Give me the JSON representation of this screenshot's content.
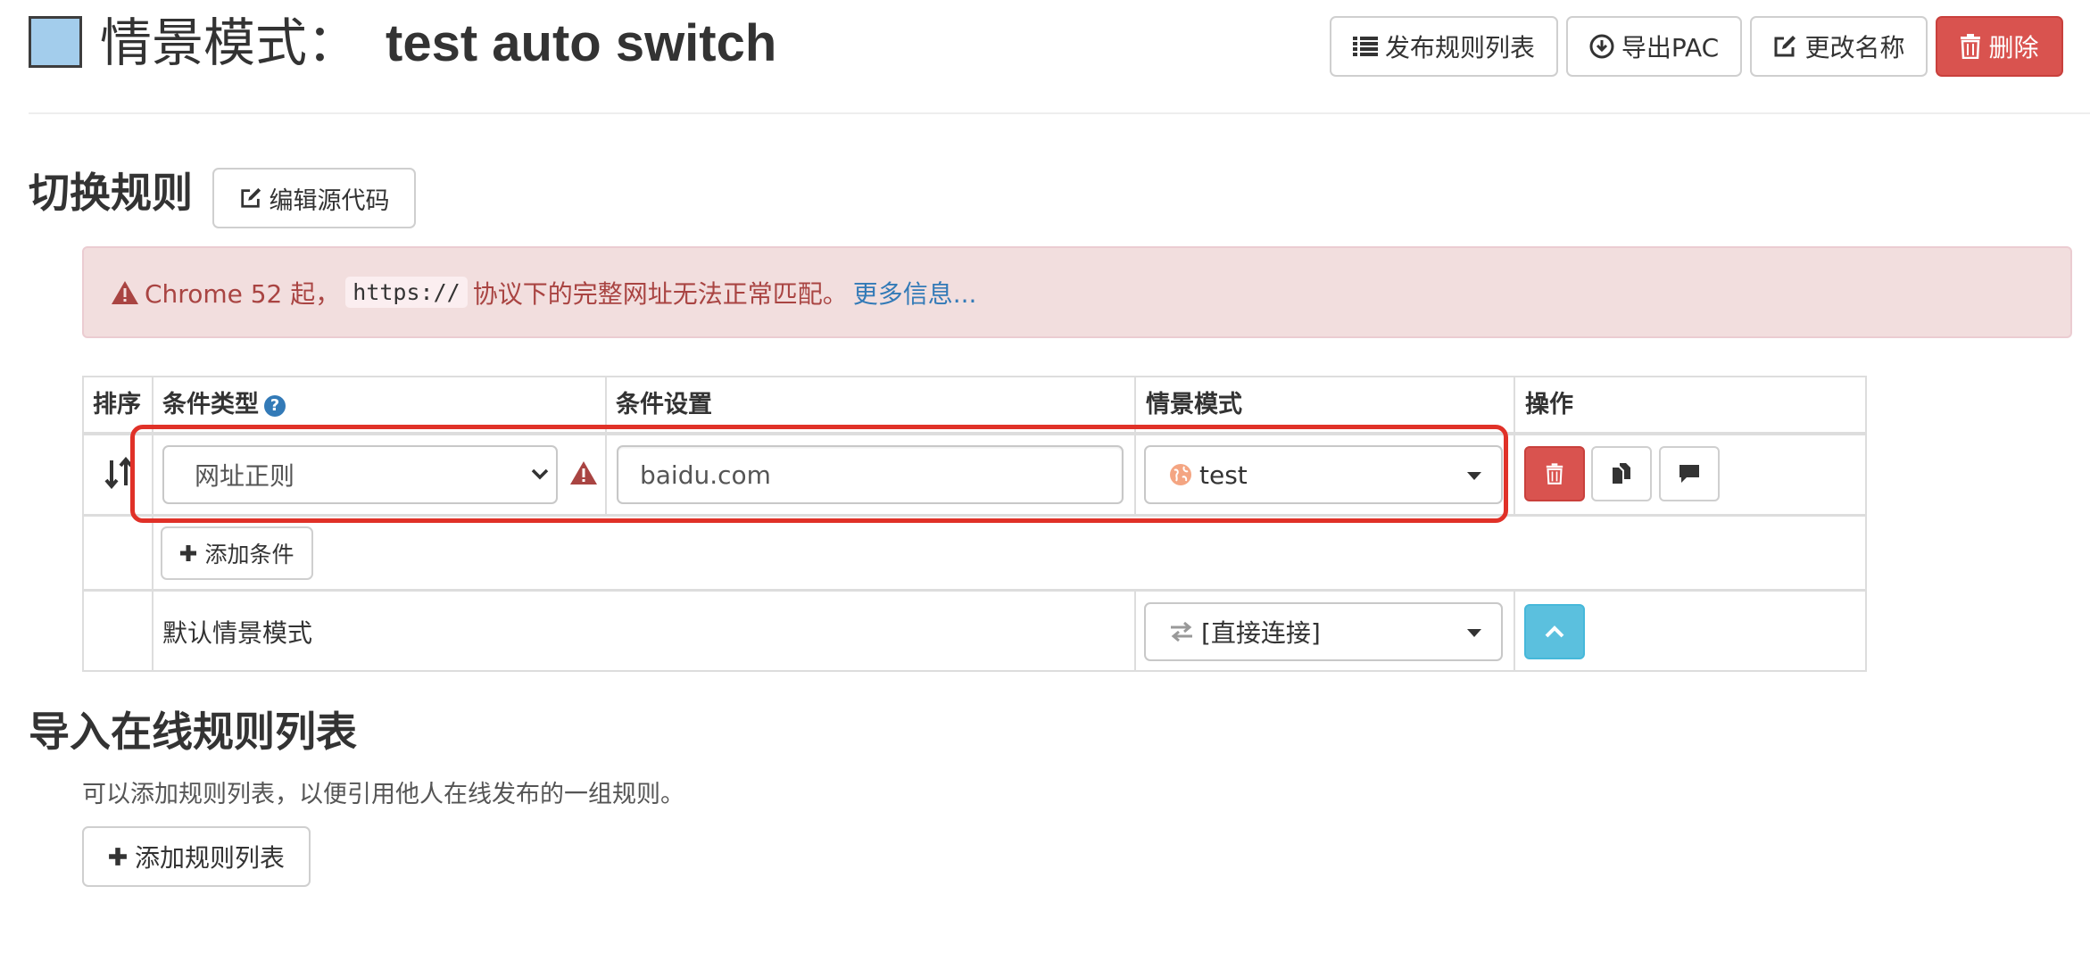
{
  "header": {
    "title_prefix": "情景模式：",
    "profile_name": "test auto switch",
    "swatch_color": "#a3cdec",
    "buttons": {
      "publish": "发布规则列表",
      "export_pac": "导出PAC",
      "rename": "更改名称",
      "delete": "删除"
    }
  },
  "switch_rules": {
    "heading": "切换规则",
    "edit_source_button": "编辑源代码",
    "alert": {
      "prefix": "Chrome 52 起，",
      "code": "https://",
      "suffix": "协议下的完整网址无法正常匹配。",
      "link": "更多信息..."
    },
    "table": {
      "headers": {
        "sort": "排序",
        "condition_type": "条件类型",
        "condition_setting": "条件设置",
        "profile": "情景模式",
        "actions": "操作"
      },
      "rows": [
        {
          "condition_type": "网址正则",
          "condition_value": "baidu.com",
          "profile": "test"
        }
      ],
      "add_condition_button": "添加条件",
      "default_label": "默认情景模式",
      "default_profile": "[直接连接]"
    }
  },
  "import_rules": {
    "heading": "导入在线规则列表",
    "description": "可以添加规则列表，以便引用他人在线发布的一组规则。",
    "add_button": "添加规则列表"
  },
  "colors": {
    "danger": "#d9534f",
    "info": "#5bc0de",
    "alert_bg": "#f2dede",
    "alert_text": "#a94442",
    "link": "#337ab7",
    "highlight": "#e03128"
  }
}
